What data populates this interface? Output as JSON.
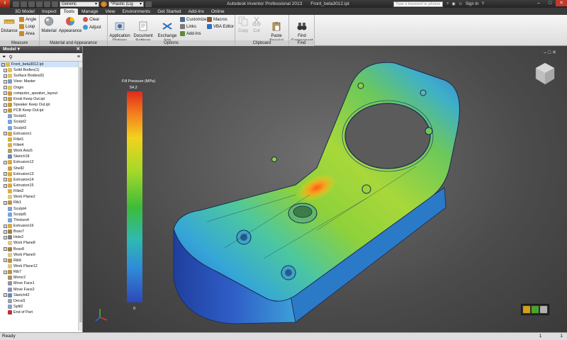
{
  "window": {
    "app_title": "Autodesk Inventor Professional 2013",
    "file_title": "Front_beta3012.ipt",
    "search_placeholder": "Type a keyword or phrase",
    "sign_in": "Sign In",
    "qat": {
      "style_value": "Generic",
      "material_value": "*Plastic (Lig"
    }
  },
  "ribbon_tabs": [
    "3D Model",
    "Inspect",
    "Tools",
    "Manage",
    "View",
    "Environments",
    "Get Started",
    "Add-Ins",
    "Online"
  ],
  "ribbon": {
    "measure": {
      "label": "Measure",
      "distance": "Distance",
      "angle": "Angle",
      "loop": "Loop",
      "area": "Area"
    },
    "material_appearance": {
      "label": "Material and Appearance",
      "material": "Material",
      "appearance": "Appearance",
      "clear": "Clear",
      "adjust": "Adjust"
    },
    "options": {
      "label": "Options",
      "application_options": "Application\nOptions",
      "document_settings": "Document\nSettings",
      "exchange": "Exchange\nApp Manager",
      "customize": "Customize",
      "links": "Links",
      "add_ins": "Add-Ins",
      "macros": "Macros",
      "vba_editor": "VBA Editor"
    },
    "clipboard": {
      "label": "Clipboard",
      "copy": "Copy",
      "cut": "Cut",
      "paste_special": "Paste\nSpecial"
    },
    "find": {
      "label": "Find",
      "find_component": "Find\nComponent"
    }
  },
  "browser": {
    "title": "Model",
    "items": [
      {
        "label": "Front_beta3012.ipt",
        "icon": "part",
        "indent": 0,
        "exp": "-"
      },
      {
        "label": "Solid Bodies(1)",
        "icon": "folder",
        "indent": 1,
        "exp": "+"
      },
      {
        "label": "Surface Bodies(6)",
        "icon": "folder",
        "indent": 1,
        "exp": "+"
      },
      {
        "label": "View: Master",
        "icon": "view",
        "indent": 1,
        "exp": "+"
      },
      {
        "label": "Origin",
        "icon": "folder",
        "indent": 1,
        "exp": "+"
      },
      {
        "label": "computer_speaker_layout",
        "icon": "derived",
        "indent": 1,
        "exp": "+"
      },
      {
        "label": "Knob Keep Out.ipt",
        "icon": "derived",
        "indent": 1,
        "exp": "+"
      },
      {
        "label": "Speaker Keep Out.ipt",
        "icon": "derived",
        "indent": 1,
        "exp": "+"
      },
      {
        "label": "PCB Keep Out.ipt",
        "icon": "derived",
        "indent": 1,
        "exp": "+"
      },
      {
        "label": "Sculpt1",
        "icon": "sculpt",
        "indent": 1,
        "exp": ""
      },
      {
        "label": "Sculpt2",
        "icon": "sculpt",
        "indent": 1,
        "exp": ""
      },
      {
        "label": "Sculpt3",
        "icon": "sculpt",
        "indent": 1,
        "exp": ""
      },
      {
        "label": "Extrusion1",
        "icon": "extrude",
        "indent": 1,
        "exp": "+"
      },
      {
        "label": "Fillet1",
        "icon": "fillet",
        "indent": 1,
        "exp": ""
      },
      {
        "label": "Fillet4",
        "icon": "fillet",
        "indent": 1,
        "exp": ""
      },
      {
        "label": "Work Axis5",
        "icon": "axis",
        "indent": 1,
        "exp": ""
      },
      {
        "label": "Sketch18",
        "icon": "sketch",
        "indent": 1,
        "exp": ""
      },
      {
        "label": "Extrusion12",
        "icon": "extrude",
        "indent": 1,
        "exp": "+"
      },
      {
        "label": "Shell2",
        "icon": "shell",
        "indent": 1,
        "exp": ""
      },
      {
        "label": "Extrusion13",
        "icon": "extrude",
        "indent": 1,
        "exp": "+"
      },
      {
        "label": "Extrusion14",
        "icon": "extrude",
        "indent": 1,
        "exp": "+"
      },
      {
        "label": "Extrusion15",
        "icon": "extrude",
        "indent": 1,
        "exp": "+"
      },
      {
        "label": "Fillet2",
        "icon": "fillet",
        "indent": 1,
        "exp": ""
      },
      {
        "label": "Work Plane2",
        "icon": "plane",
        "indent": 1,
        "exp": ""
      },
      {
        "label": "Rib1",
        "icon": "rib",
        "indent": 1,
        "exp": "+"
      },
      {
        "label": "Sculpt4",
        "icon": "sculpt",
        "indent": 1,
        "exp": ""
      },
      {
        "label": "Sculpt5",
        "icon": "sculpt",
        "indent": 1,
        "exp": ""
      },
      {
        "label": "Thicken4",
        "icon": "sculpt",
        "indent": 1,
        "exp": ""
      },
      {
        "label": "Extrusion16",
        "icon": "extrude",
        "indent": 1,
        "exp": "+"
      },
      {
        "label": "Boss7",
        "icon": "boss",
        "indent": 1,
        "exp": "+"
      },
      {
        "label": "Hole2",
        "icon": "hole",
        "indent": 1,
        "exp": "+"
      },
      {
        "label": "Work Plane8",
        "icon": "plane",
        "indent": 1,
        "exp": ""
      },
      {
        "label": "Boss8",
        "icon": "boss",
        "indent": 1,
        "exp": "+"
      },
      {
        "label": "Work Plane9",
        "icon": "plane",
        "indent": 1,
        "exp": ""
      },
      {
        "label": "Rib6",
        "icon": "rib",
        "indent": 1,
        "exp": "+"
      },
      {
        "label": "Work Plane12",
        "icon": "plane",
        "indent": 1,
        "exp": ""
      },
      {
        "label": "Rib7",
        "icon": "rib",
        "indent": 1,
        "exp": "+"
      },
      {
        "label": "Mirror2",
        "icon": "mirror",
        "indent": 1,
        "exp": ""
      },
      {
        "label": "Move Face1",
        "icon": "move",
        "indent": 1,
        "exp": ""
      },
      {
        "label": "Move Face2",
        "icon": "move",
        "indent": 1,
        "exp": ""
      },
      {
        "label": "Sketch42",
        "icon": "sketch",
        "indent": 1,
        "exp": "+"
      },
      {
        "label": "Decal1",
        "icon": "decal",
        "indent": 1,
        "exp": ""
      },
      {
        "label": "Split2",
        "icon": "split",
        "indent": 1,
        "exp": ""
      },
      {
        "label": "End of Part",
        "icon": "end",
        "indent": 1,
        "exp": ""
      }
    ]
  },
  "viewport": {
    "legend_title": "Fill Pressure (MPa)",
    "legend_max": "54.2",
    "legend_min": "0"
  },
  "status": {
    "text": "Ready",
    "val1": "1",
    "val2": "1"
  },
  "colors": {
    "accent": "#2f6fc0",
    "ribbon_bg": "#e4e4e4",
    "titlebar": "#2e2e2e"
  }
}
